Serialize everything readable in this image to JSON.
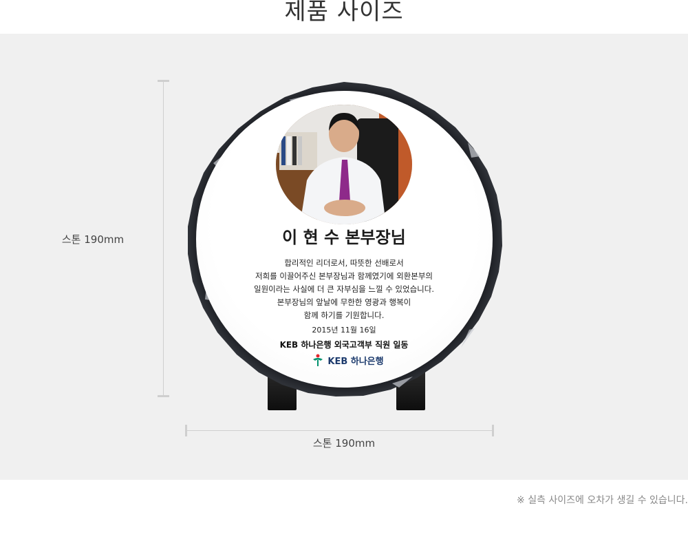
{
  "header": {
    "title": "제품 사이즈"
  },
  "dimensions": {
    "height_label": "스톤  190mm",
    "width_label": "스톤  190mm"
  },
  "product": {
    "name": "이 현 수 본부장님",
    "message_lines": [
      "합리적인 리더로서, 따뜻한 선배로서",
      "저희를 이끌어주신 본부장님과 함께였기에 외환본부의",
      "일원이라는 사실에 더 큰 자부심을 느낄 수 있었습니다.",
      "본부장님의 앞날에 무한한 영광과 행복이",
      "함께 하기를 기원합니다."
    ],
    "date": "2015년 11월 16일",
    "from": "KEB 하나은행 외국고객부 직원 일동",
    "bank_logo_text": "KEB 하나은행",
    "logo_icon": "keb-hana-logo-icon",
    "accent_color": "#00916e"
  },
  "footer": {
    "note": "※ 실측 사이즈에 오차가 생길 수 있습니다."
  }
}
